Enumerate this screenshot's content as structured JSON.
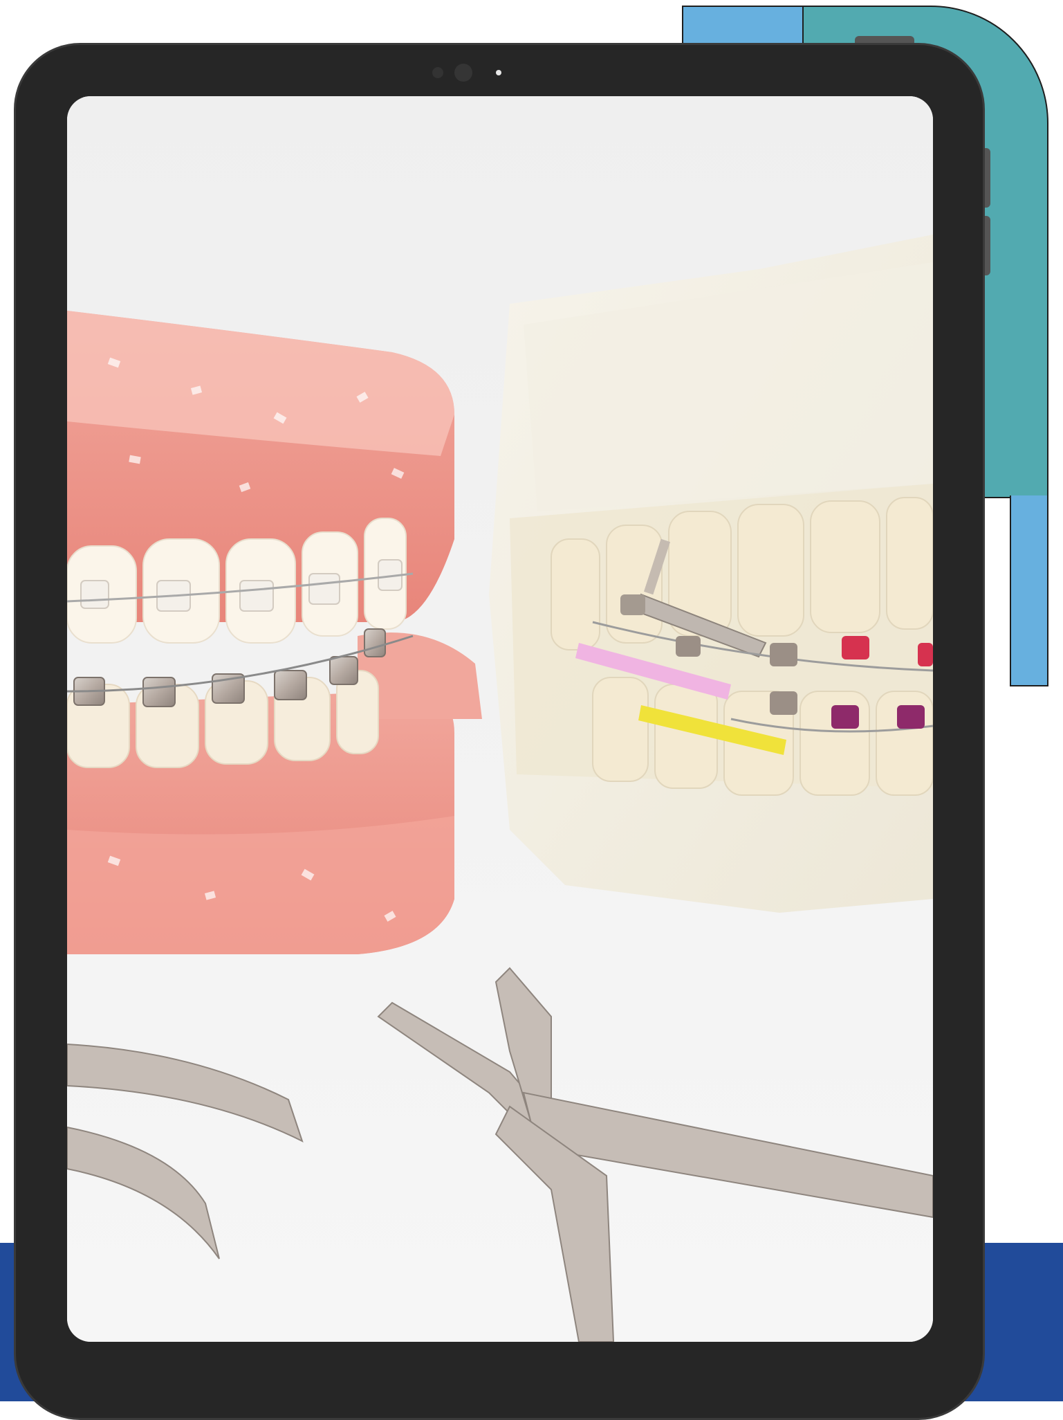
{
  "colors": {
    "background": "#ffffff",
    "accent_teal": "#52aab0",
    "accent_light_blue": "#67b0df",
    "accent_navy": "#214b9a",
    "tablet_bezel": "#262626",
    "outline": "#1e1e1e"
  },
  "screen_image": {
    "description_label": "photo",
    "icon": "orthodontic-models-photo"
  }
}
